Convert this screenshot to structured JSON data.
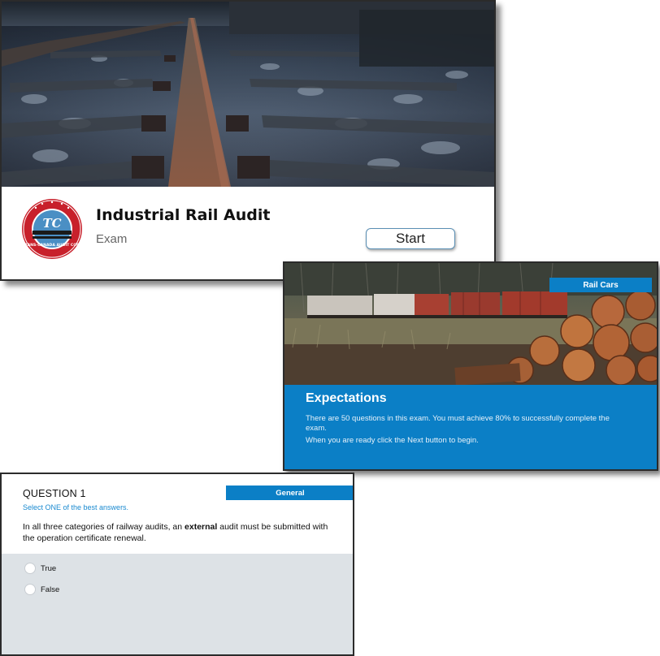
{
  "cover": {
    "logo_text": "TC",
    "logo_ring_text": "TRANS-CANADA AUDIT CORP",
    "title": "Industrial Rail Audit",
    "subtitle": "Exam",
    "start_label": "Start"
  },
  "expectations": {
    "tag": "Rail Cars",
    "heading": "Expectations",
    "paragraph1": "There are 50 questions in this exam. You must achieve 80% to successfully complete the exam.",
    "paragraph2": "When you are ready click the Next button to begin."
  },
  "question": {
    "number": "QUESTION 1",
    "tag": "General",
    "instruction": "Select ONE of the best answers.",
    "text_before": "In all three categories of railway audits, an ",
    "text_bold": "external",
    "text_after": " audit must be submitted with the operation certificate renewal.",
    "choices": [
      {
        "label": "True"
      },
      {
        "label": "False"
      }
    ]
  },
  "colors": {
    "accent": "#0b7fc6",
    "answer_bg": "#dde2e6",
    "logo_red": "#c8202b"
  }
}
